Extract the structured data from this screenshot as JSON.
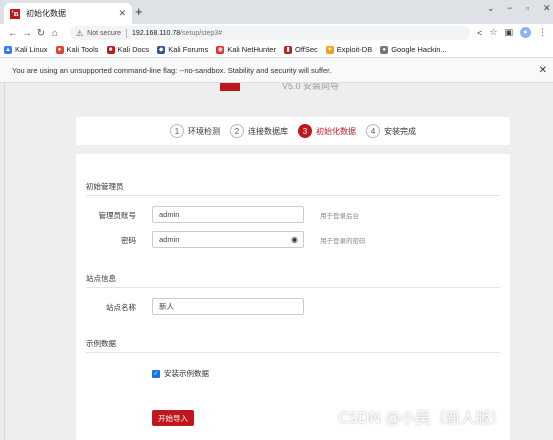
{
  "browser": {
    "tab_title": "初始化数据",
    "favicon_glyph": "ʼn",
    "url_warning": "Not secure",
    "url_host": "192.168.110.78",
    "url_path": "/setup/step3#",
    "bookmarks": [
      {
        "label": "Kali Linux",
        "color": "#367bf0"
      },
      {
        "label": "Kali Tools",
        "color": "#e34234"
      },
      {
        "label": "Kali Docs",
        "color": "#c0161e"
      },
      {
        "label": "Kali Forums",
        "color": "#2b5797"
      },
      {
        "label": "Kali NetHunter",
        "color": "#d33"
      },
      {
        "label": "OffSec",
        "color": "#b22222"
      },
      {
        "label": "Exploit-DB",
        "color": "#f0a020"
      },
      {
        "label": "Google Hackin...",
        "color": "#777"
      }
    ],
    "infobar_message": "You are using an unsupported command-line flag: --no-sandbox. Stability and security will suffer."
  },
  "logo_text": "V5.0 安装向导",
  "steps": [
    {
      "num": "1",
      "label": "环境检测",
      "active": false
    },
    {
      "num": "2",
      "label": "连接数据库",
      "active": false
    },
    {
      "num": "3",
      "label": "初始化数据",
      "active": true
    },
    {
      "num": "4",
      "label": "安装完成",
      "active": false
    }
  ],
  "form": {
    "admin_section": "初始管理员",
    "admin_account_label": "管理员账号",
    "admin_account_value": "admin",
    "admin_account_hint": "用于登录后台",
    "password_label": "密码",
    "password_value": "admin",
    "password_hint": "用于登录的密码",
    "site_section": "站点信息",
    "site_name_label": "站点名称",
    "site_name_value": "新人",
    "sample_section": "示例数据",
    "sample_checkbox_label": "安装示例数据",
    "sample_checked": true,
    "submit_label": "开始导入"
  },
  "watermark": "CSDN @小吴（新人版）",
  "accent_color": "#c0161e"
}
